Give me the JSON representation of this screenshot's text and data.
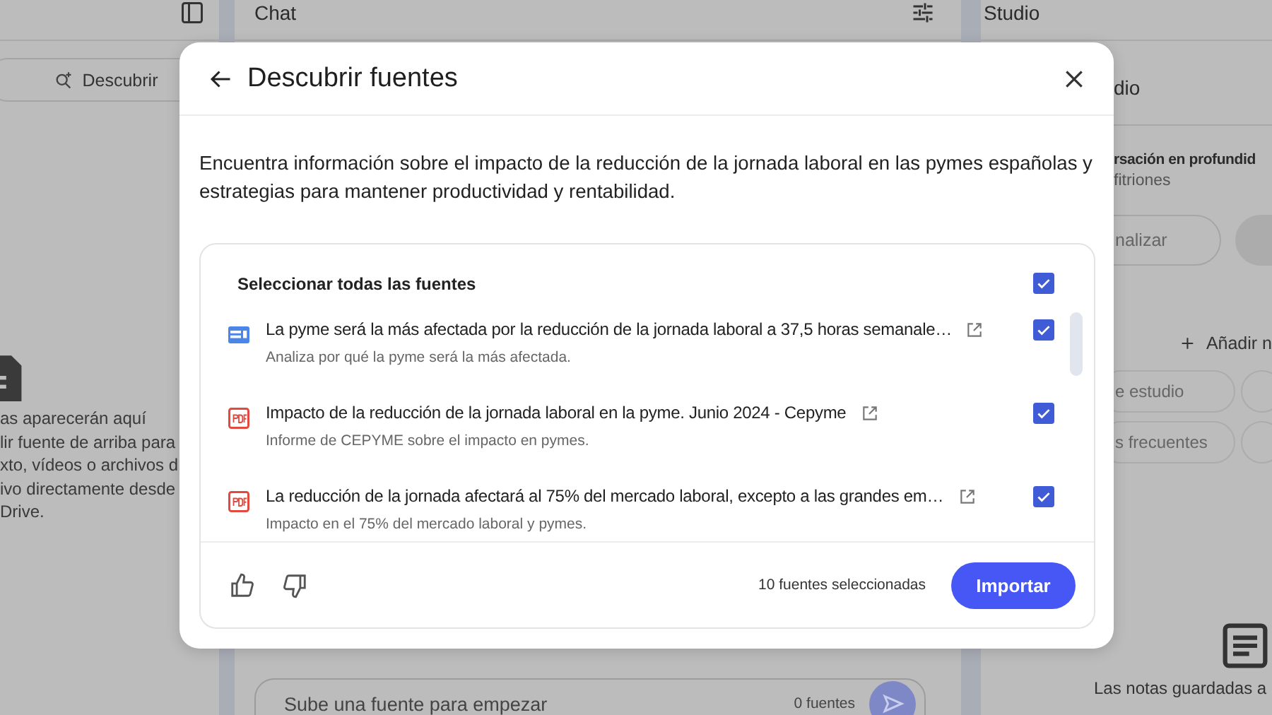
{
  "sources_panel": {
    "discover_button": "Descubrir",
    "empty_text_lines": [
      "as aparecerán aquí",
      "lir fuente de arriba para",
      "xto, vídeos o archivos d",
      "ivo directamente desde",
      "Drive."
    ]
  },
  "chat_panel": {
    "title": "Chat",
    "input_placeholder": "Sube una fuente para empezar",
    "source_count": "0 fuentes"
  },
  "studio_panel": {
    "title": "Studio",
    "audio_title": "dio",
    "audio_heading": "rsación en profundid",
    "audio_subtitle": "fitriones",
    "customize_button": "nalizar",
    "add_note_button": "Añadir n",
    "chips": [
      "e estudio",
      "s frecuentes"
    ],
    "notes_empty": "Las notas guardadas a"
  },
  "dialog": {
    "title": "Descubrir fuentes",
    "description": "Encuentra información sobre el impacto de la reducción de la jornada laboral en las pymes españolas y estrategias para mantener productividad y rentabilidad.",
    "select_all": {
      "label": "Seleccionar todas las fuentes",
      "checked": true
    },
    "sources": [
      {
        "kind": "web",
        "title": "La pyme será la más afectada por la reducción de la jornada laboral a 37,5 horas semanale…",
        "summary": "Analiza por qué la pyme será la más afectada.",
        "checked": true
      },
      {
        "kind": "pdf",
        "title": "Impacto de la reducción de la jornada laboral en la pyme. Junio 2024 - Cepyme",
        "summary": "Informe de CEPYME sobre el impacto en pymes.",
        "checked": true
      },
      {
        "kind": "pdf",
        "title": "La reducción de la jornada afectará al 75% del mercado laboral, excepto a las grandes em…",
        "summary": "Impacto en el 75% del mercado laboral y pymes.",
        "checked": true
      }
    ],
    "selected_count": "10 fuentes seleccionadas",
    "import_button": "Importar"
  }
}
